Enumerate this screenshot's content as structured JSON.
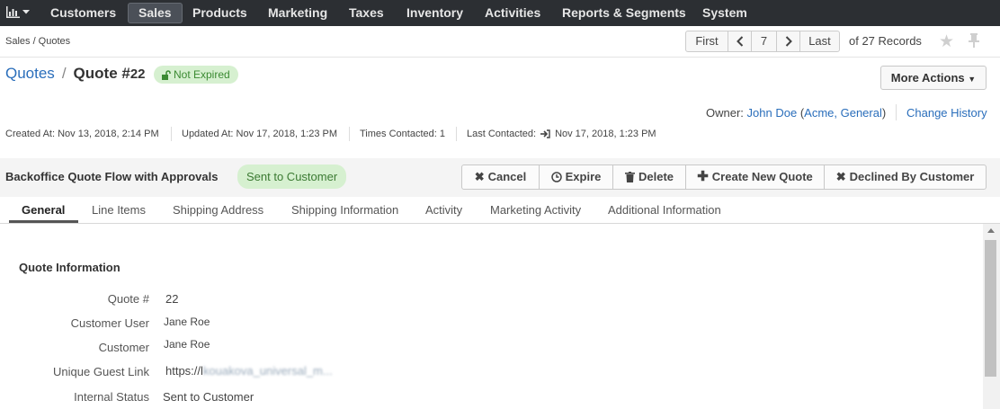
{
  "nav": {
    "items": [
      "Customers",
      "Sales",
      "Products",
      "Marketing",
      "Taxes",
      "Inventory",
      "Activities",
      "Reports & Segments",
      "System"
    ],
    "active": "Sales"
  },
  "breadcrumb": "Sales / Quotes",
  "pager": {
    "first": "First",
    "page": "7",
    "last": "Last",
    "records": "of 27 Records"
  },
  "title": {
    "crumb": "Quotes",
    "separator": "/",
    "name": "Quote #",
    "number": "22",
    "status_badge": "Not Expired"
  },
  "more_actions": "More Actions",
  "owner": {
    "label": "Owner:",
    "name": "John Doe",
    "org_open": "(",
    "org": "Acme, General",
    "org_close": ")",
    "change_history": "Change History"
  },
  "meta": {
    "created": "Created At: Nov 13, 2018, 2:14 PM",
    "updated": "Updated At: Nov 17, 2018, 1:23 PM",
    "times_contacted": "Times Contacted: 1",
    "last_contacted_label": "Last Contacted:",
    "last_contacted_value": "Nov 17, 2018, 1:23 PM"
  },
  "workflow": {
    "name": "Backoffice Quote Flow with Approvals",
    "step": "Sent to Customer",
    "buttons": [
      "Cancel",
      "Expire",
      "Delete",
      "Create New Quote",
      "Declined By Customer"
    ]
  },
  "tabs": [
    "General",
    "Line Items",
    "Shipping Address",
    "Shipping Information",
    "Activity",
    "Marketing Activity",
    "Additional Information"
  ],
  "active_tab": "General",
  "section": {
    "title": "Quote Information",
    "fields": [
      {
        "label": "Quote #",
        "value": "22"
      },
      {
        "label": "Customer User",
        "value": "Jane Roe"
      },
      {
        "label": "Customer",
        "value": "Jane Roe"
      },
      {
        "label": "Unique Guest Link",
        "value": "https://l",
        "value_obscured": "kouakova_universal_m..."
      },
      {
        "label": "Internal Status",
        "value": "Sent to Customer"
      }
    ]
  },
  "colors": {
    "nav_bg": "#2c2f33",
    "link": "#2a6ebb",
    "badge_bg": "#d6f0d0",
    "badge_text": "#3b8a32"
  }
}
